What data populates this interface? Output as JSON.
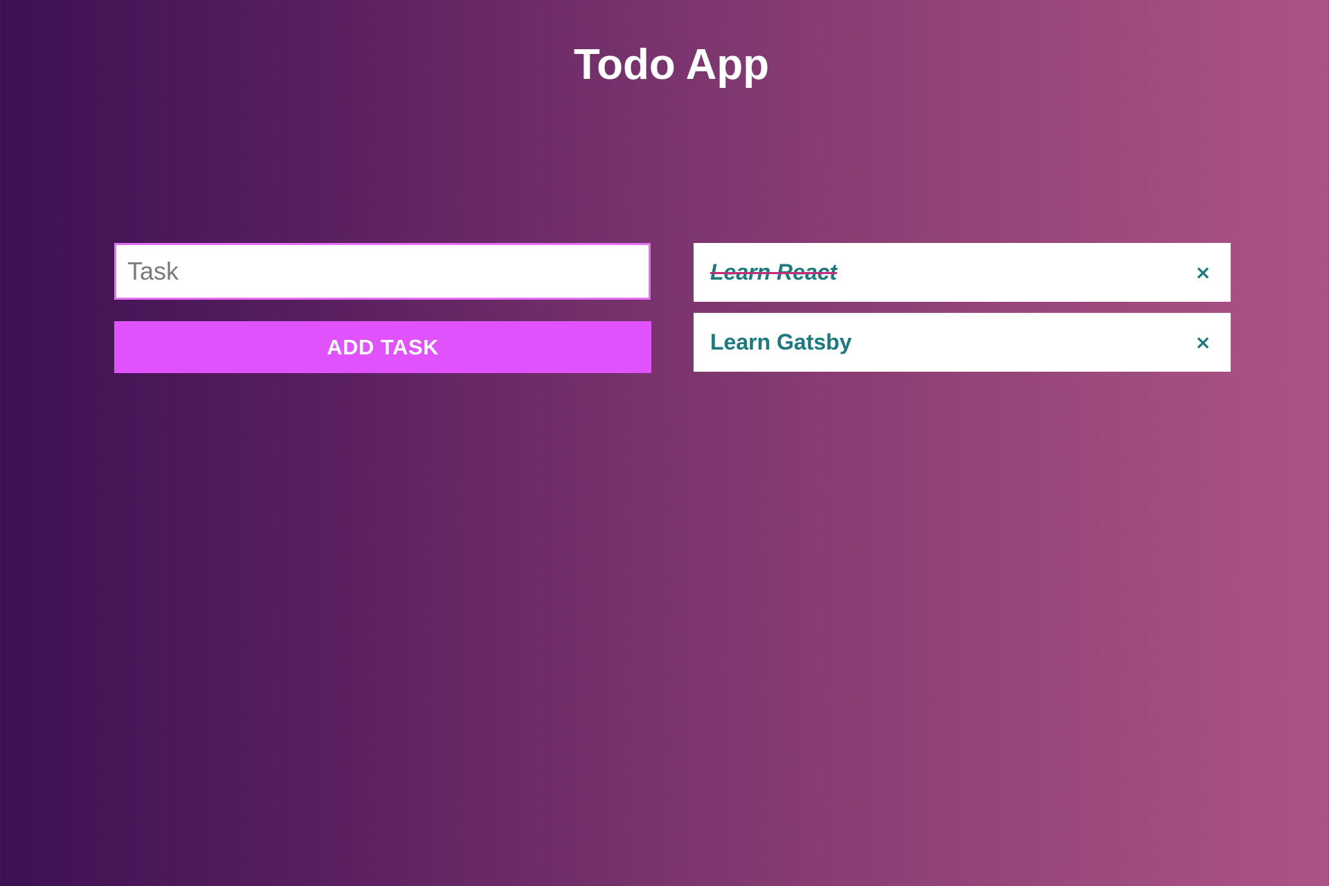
{
  "header": {
    "title": "Todo App"
  },
  "form": {
    "input_placeholder": "Task",
    "input_value": "",
    "add_button_label": "ADD TASK"
  },
  "tasks": [
    {
      "text": "Learn React",
      "completed": true,
      "delete_icon": "close-icon",
      "delete_glyph": "×"
    },
    {
      "text": "Learn Gatsby",
      "completed": false,
      "delete_icon": "close-icon",
      "delete_glyph": "×"
    }
  ],
  "colors": {
    "background_start": "#3d1152",
    "background_end": "#ad5385",
    "accent": "#e052fb",
    "input_border": "#e670f2",
    "task_text": "#1a7a7e",
    "strike": "#c0307a"
  }
}
